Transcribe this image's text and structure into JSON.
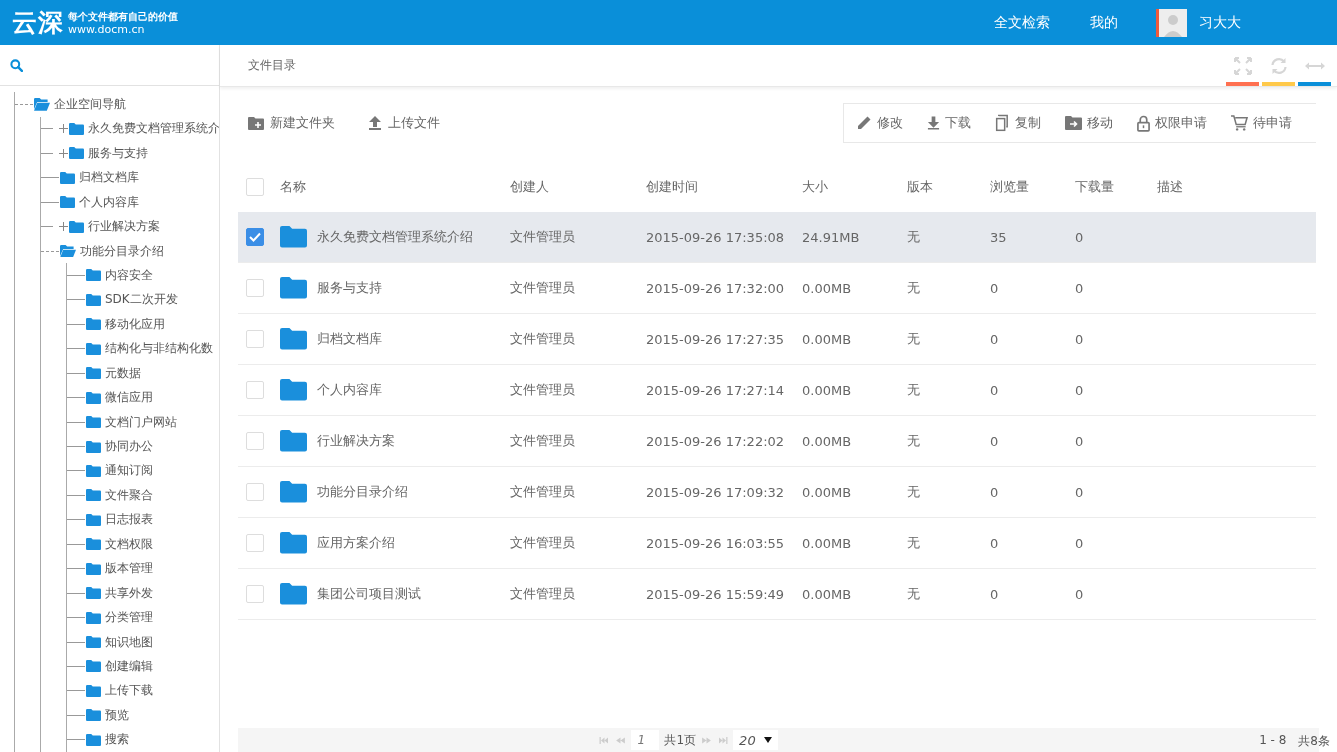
{
  "header": {
    "logo_title": "云深",
    "logo_slogan": "每个文件都有自己的价值",
    "logo_url": "www.docm.cn",
    "nav": [
      {
        "label": "全文检索"
      },
      {
        "label": "我的"
      }
    ],
    "user_name": "习大大"
  },
  "sidebar": {
    "tree": [
      {
        "label": "企业空间导航",
        "expanded": true,
        "expandable": true,
        "children": [
          {
            "label": "永久免费文档管理系统介",
            "expanded": false,
            "expandable": true
          },
          {
            "label": "服务与支持",
            "expanded": false,
            "expandable": true
          },
          {
            "label": "归档文档库",
            "expanded": false,
            "expandable": false
          },
          {
            "label": "个人内容库",
            "expanded": false,
            "expandable": false
          },
          {
            "label": "行业解决方案",
            "expanded": false,
            "expandable": true
          },
          {
            "label": "功能分目录介绍",
            "expanded": true,
            "expandable": true,
            "children": [
              {
                "label": "内容安全",
                "expanded": false,
                "expandable": false
              },
              {
                "label": "SDK二次开发",
                "expanded": false,
                "expandable": false
              },
              {
                "label": "移动化应用",
                "expanded": false,
                "expandable": false
              },
              {
                "label": "结构化与非结构化数",
                "expanded": false,
                "expandable": false
              },
              {
                "label": "元数据",
                "expanded": false,
                "expandable": false
              },
              {
                "label": "微信应用",
                "expanded": false,
                "expandable": false
              },
              {
                "label": "文档门户网站",
                "expanded": false,
                "expandable": false
              },
              {
                "label": "协同办公",
                "expanded": false,
                "expandable": false
              },
              {
                "label": "通知订阅",
                "expanded": false,
                "expandable": false
              },
              {
                "label": "文件聚合",
                "expanded": false,
                "expandable": false
              },
              {
                "label": "日志报表",
                "expanded": false,
                "expandable": false
              },
              {
                "label": "文档权限",
                "expanded": false,
                "expandable": false
              },
              {
                "label": "版本管理",
                "expanded": false,
                "expandable": false
              },
              {
                "label": "共享外发",
                "expanded": false,
                "expandable": false
              },
              {
                "label": "分类管理",
                "expanded": false,
                "expandable": false
              },
              {
                "label": "知识地图",
                "expanded": false,
                "expandable": false
              },
              {
                "label": "创建编辑",
                "expanded": false,
                "expandable": false
              },
              {
                "label": "上传下载",
                "expanded": false,
                "expandable": false
              },
              {
                "label": "预览",
                "expanded": false,
                "expandable": false
              },
              {
                "label": "搜索",
                "expanded": false,
                "expandable": false
              }
            ]
          }
        ]
      }
    ]
  },
  "breadcrumb": "文件目录",
  "tool_buttons": [
    {
      "kind": "fullscreen",
      "color": "#ff7050"
    },
    {
      "kind": "refresh",
      "color": "#ffc94a"
    },
    {
      "kind": "arrows",
      "color": "#0a8fd9"
    }
  ],
  "actions_left": [
    {
      "kind": "new_folder",
      "label": "新建文件夹"
    },
    {
      "kind": "upload",
      "label": "上传文件"
    }
  ],
  "actions_right": [
    {
      "kind": "edit",
      "label": "修改"
    },
    {
      "kind": "download",
      "label": "下载"
    },
    {
      "kind": "copy",
      "label": "复制"
    },
    {
      "kind": "move",
      "label": "移动"
    },
    {
      "kind": "lock",
      "label": "权限申请"
    },
    {
      "kind": "cart",
      "label": "待申请"
    }
  ],
  "table": {
    "select_all": false,
    "columns": [
      "名称",
      "创建人",
      "创建时间",
      "大小",
      "版本",
      "浏览量",
      "下载量",
      "描述"
    ],
    "rows": [
      {
        "selected": true,
        "cells": [
          "永久免费文档管理系统介绍",
          "文件管理员",
          "2015-09-26 17:35:08",
          "24.91MB",
          "无",
          "35",
          "0"
        ]
      },
      {
        "selected": false,
        "cells": [
          "服务与支持",
          "文件管理员",
          "2015-09-26 17:32:00",
          "0.00MB",
          "无",
          "0",
          "0"
        ]
      },
      {
        "selected": false,
        "cells": [
          "归档文档库",
          "文件管理员",
          "2015-09-26 17:27:35",
          "0.00MB",
          "无",
          "0",
          "0"
        ]
      },
      {
        "selected": false,
        "cells": [
          "个人内容库",
          "文件管理员",
          "2015-09-26 17:27:14",
          "0.00MB",
          "无",
          "0",
          "0"
        ]
      },
      {
        "selected": false,
        "cells": [
          "行业解决方案",
          "文件管理员",
          "2015-09-26 17:22:02",
          "0.00MB",
          "无",
          "0",
          "0"
        ]
      },
      {
        "selected": false,
        "cells": [
          "功能分目录介绍",
          "文件管理员",
          "2015-09-26 17:09:32",
          "0.00MB",
          "无",
          "0",
          "0"
        ]
      },
      {
        "selected": false,
        "cells": [
          "应用方案介绍",
          "文件管理员",
          "2015-09-26 16:03:55",
          "0.00MB",
          "无",
          "0",
          "0"
        ]
      },
      {
        "selected": false,
        "cells": [
          "集团公司项目测试",
          "文件管理员",
          "2015-09-26 15:59:49",
          "0.00MB",
          "无",
          "0",
          "0"
        ]
      }
    ]
  },
  "pager": {
    "page": "1",
    "total_pages": "共1页",
    "page_size": "20",
    "summary": "1 - 8",
    "total": "共8条"
  }
}
